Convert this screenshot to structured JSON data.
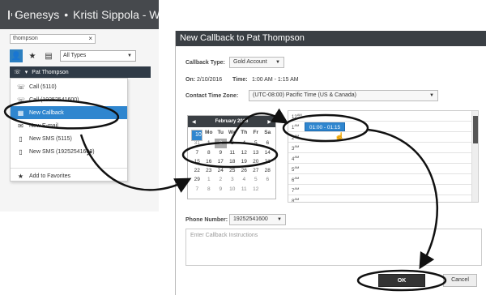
{
  "app": {
    "title": "Genesys",
    "separator": "•",
    "user_name": "Kristi Sippola - W"
  },
  "search": {
    "value": "thompson",
    "clear_glyph": "×"
  },
  "filter": {
    "type_value": "All Types",
    "caret": "▼"
  },
  "contact": {
    "name": "Pat Thompson"
  },
  "menu": {
    "items": [
      {
        "label": "Call (5110)",
        "icon": "phone-icon",
        "glyph": "☏"
      },
      {
        "label": "Call (19252541600)",
        "icon": "phone-icon",
        "glyph": "☏"
      },
      {
        "label": "New Callback",
        "icon": "calendar-icon",
        "glyph": "▦"
      },
      {
        "label": "New E-mail",
        "icon": "email-icon",
        "glyph": "✉"
      },
      {
        "label": "New SMS (5115)",
        "icon": "mobile-icon",
        "glyph": "▯"
      },
      {
        "label": "New SMS (19252541600)",
        "icon": "mobile-icon",
        "glyph": "▯"
      },
      {
        "label": "Add to Favorites",
        "icon": "star-icon",
        "glyph": "★"
      }
    ]
  },
  "dialog": {
    "title": "New Callback to Pat Thompson",
    "callback_type_label": "Callback Type:",
    "callback_type_value": "Gold Account",
    "on_label": "On:",
    "on_value": "2/10/2016",
    "time_label": "Time:",
    "time_value": "1:00 AM - 1:15 AM",
    "timezone_label": "Contact Time Zone:",
    "timezone_value": "(UTC-08:00) Pacific Time (US & Canada)",
    "phone_label": "Phone Number:",
    "phone_value": "19252541600",
    "notes_placeholder": "Enter Callback Instructions",
    "ok_label": "OK",
    "cancel_label": "Cancel"
  },
  "calendar": {
    "month": "February 2016",
    "prev_glyph": "◀",
    "next_glyph": "▶",
    "weekdays": [
      "Su",
      "Mo",
      "Tu",
      "We",
      "Th",
      "Fr",
      "Sa"
    ],
    "weeks": [
      [
        "31",
        "1",
        "2",
        "3",
        "4",
        "5",
        "6"
      ],
      [
        "7",
        "8",
        "9",
        "10",
        "11",
        "12",
        "13"
      ],
      [
        "14",
        "15",
        "16",
        "17",
        "18",
        "19",
        "20"
      ],
      [
        "21",
        "22",
        "23",
        "24",
        "25",
        "26",
        "27"
      ],
      [
        "28",
        "29",
        "1",
        "2",
        "3",
        "4",
        "5"
      ],
      [
        "6",
        "7",
        "8",
        "9",
        "10",
        "11",
        "12"
      ]
    ],
    "today": "2",
    "selected": "10"
  },
  "timegrid": {
    "hours": [
      "12",
      "1",
      "2",
      "3",
      "4",
      "5",
      "6",
      "7",
      "8"
    ],
    "suffix": "AM",
    "slot_label": "01:00 - 01:15"
  },
  "colors": {
    "accent": "#2f86cf",
    "titlebar": "#3a3f44",
    "annotation": "#111111"
  }
}
